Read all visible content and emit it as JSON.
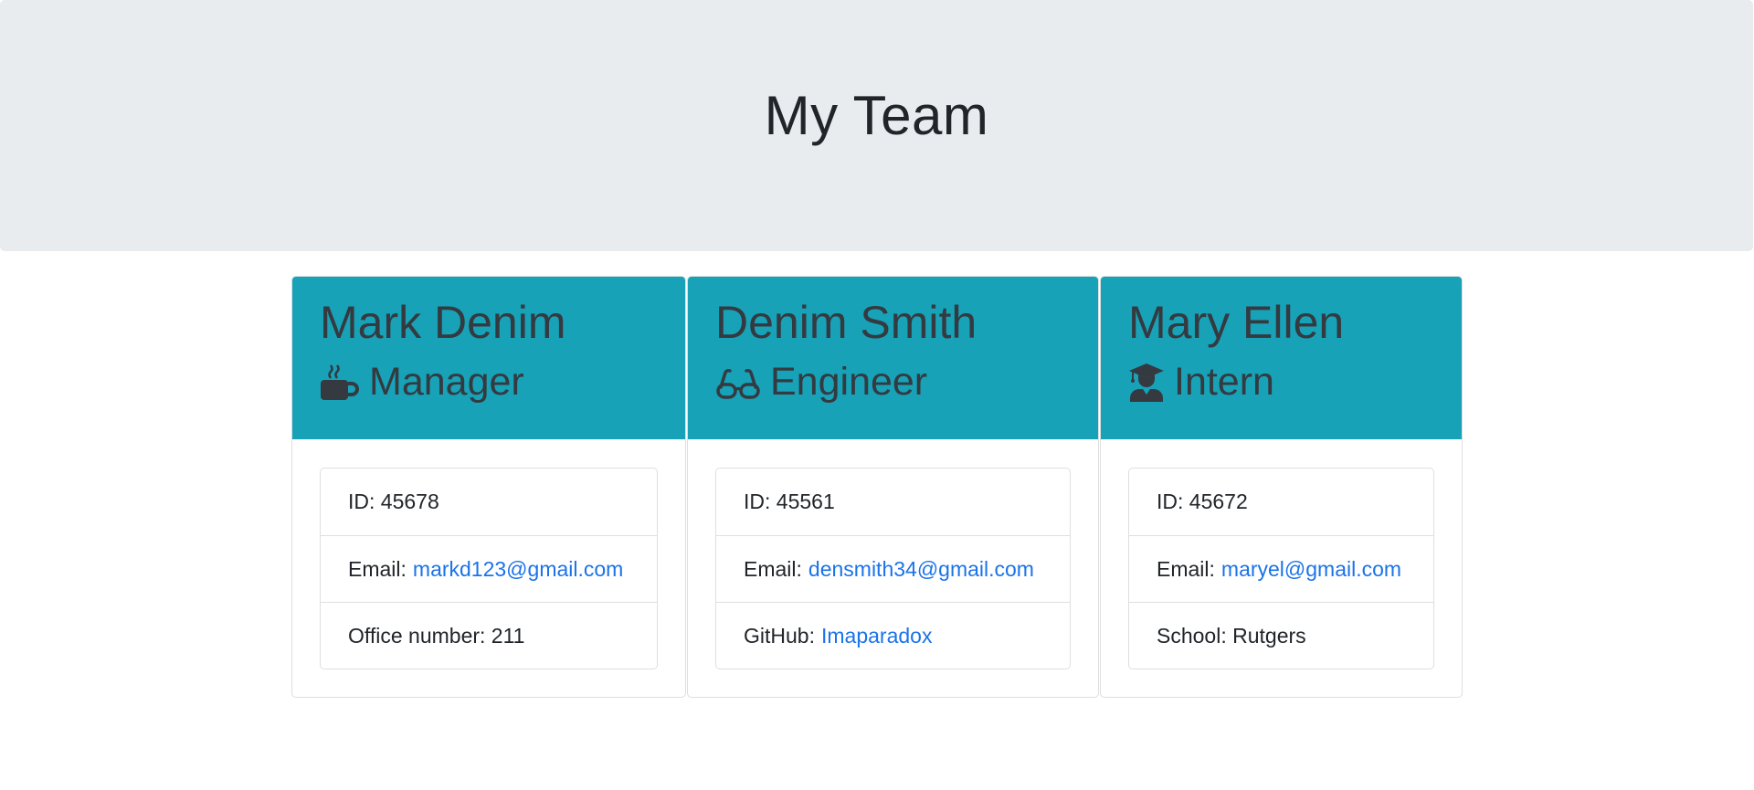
{
  "header": {
    "title": "My Team"
  },
  "employees": [
    {
      "name": "Mark Denim",
      "role": "Manager",
      "role_icon": "coffee-mug-icon",
      "id_text": "ID: 45678",
      "email_label": "Email:",
      "email": "markd123@gmail.com",
      "extra_label": "Office number: 211",
      "extra_link": ""
    },
    {
      "name": "Denim Smith",
      "role": "Engineer",
      "role_icon": "glasses-icon",
      "id_text": "ID: 45561",
      "email_label": "Email:",
      "email": "densmith34@gmail.com",
      "extra_label": "GitHub:",
      "extra_link": "Imaparadox"
    },
    {
      "name": "Mary Ellen",
      "role": "Intern",
      "role_icon": "graduate-icon",
      "id_text": "ID: 45672",
      "email_label": "Email:",
      "email": "maryel@gmail.com",
      "extra_label": "School: Rutgers",
      "extra_link": ""
    }
  ],
  "colors": {
    "header_bg": "#e9ecef",
    "card_header_bg": "#17a2b8",
    "link": "#1a73e8",
    "text": "#212529"
  }
}
